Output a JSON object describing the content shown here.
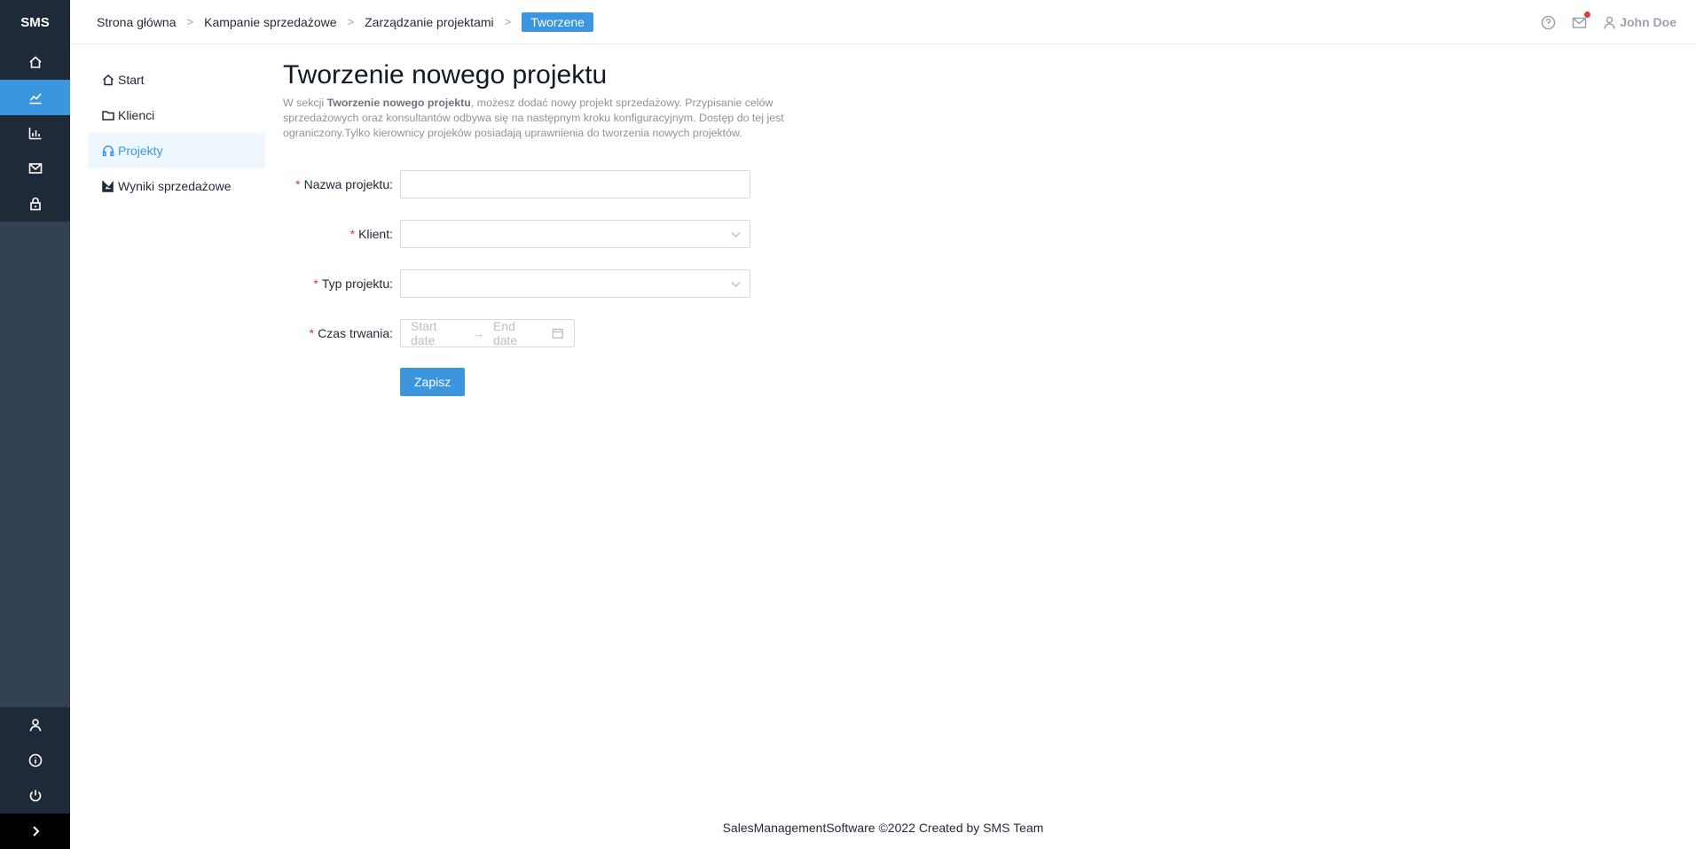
{
  "app": {
    "logo": "SMS"
  },
  "rail": {
    "top_icons": [
      "home-icon",
      "line-chart-icon",
      "bar-chart-icon",
      "mail-icon",
      "lock-icon"
    ],
    "bottom_icons": [
      "user-icon",
      "info-icon",
      "power-icon"
    ],
    "expand_icon": "chevron-right-icon"
  },
  "breadcrumb": {
    "items": [
      "Strona główna",
      "Kampanie sprzedażowe",
      "Zarządzanie projektami"
    ],
    "separator": ">",
    "active": "Tworzene"
  },
  "header": {
    "user_name": "John Doe"
  },
  "submenu": {
    "items": [
      {
        "label": "Start",
        "icon": "home-icon"
      },
      {
        "label": "Klienci",
        "icon": "folder-icon"
      },
      {
        "label": "Projekty",
        "icon": "headphones-icon"
      },
      {
        "label": "Wyniki sprzedażowe",
        "icon": "area-chart-icon"
      }
    ]
  },
  "page": {
    "title": "Tworzenie nowego projektu",
    "desc_prefix": "W sekcji ",
    "desc_bold": "Tworzenie nowego projektu",
    "desc_rest": ", możesz dodać nowy projekt sprzedażowy. Przypisanie celów sprzedażowych oraz konsultantów odbywa się na następnym kroku konfiguracyjnym. Dostęp do tej jest ograniczony.Tylko kierownicy projeków posiadają uprawnienia do tworzenia nowych projektów."
  },
  "form": {
    "required_mark": "*",
    "name_label": "Nazwa projektu",
    "client_label": "Klient",
    "type_label": "Typ projektu",
    "duration_label": "Czas trwania",
    "label_suffix": ":",
    "start_placeholder": "Start date",
    "end_placeholder": "End date",
    "range_arrow": "→",
    "submit_label": "Zapisz"
  },
  "footer": {
    "text": "SalesManagementSoftware ©2022 Created by SMS Team"
  },
  "colors": {
    "accent": "#3b96dd",
    "rail": "#344154",
    "rail_dark": "#1f2a38",
    "required": "#e53935"
  }
}
